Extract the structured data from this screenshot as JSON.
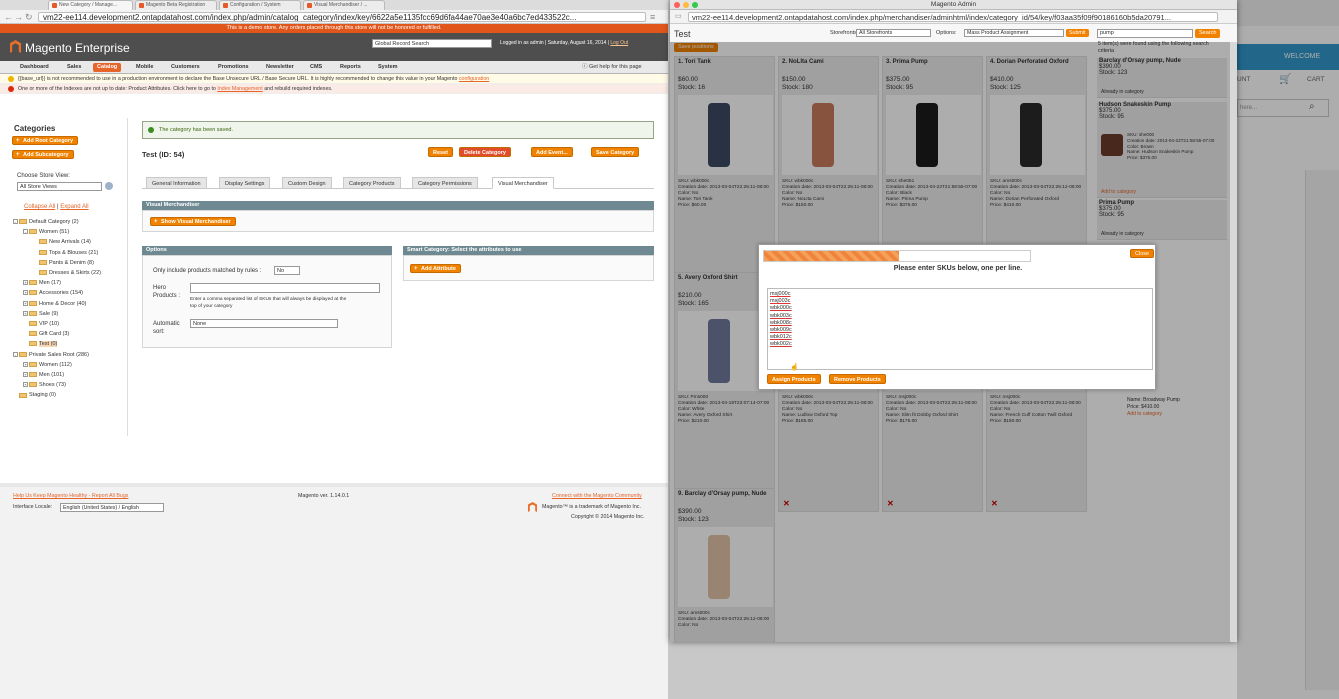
{
  "left_browser": {
    "tabs": [
      "New Category / Manage...",
      "Magento Beta Registration",
      "Configuration / System",
      "Visual Merchandiser / ..."
    ],
    "url": "vm22-ee114.development2.ontapdatahost.com/index.php/admin/catalog_category/index/key/6622a5e1135fcc69d6fa44ae70ae3e40a6bc7ed433522c...",
    "demo_notice": "This is a demo store. Any orders placed through this store will not be honored or fulfilled.",
    "logo_text": "Magento Enterprise",
    "global_search_placeholder": "Global Record Search",
    "header_meta_prefix": "Logged in as admin | Saturday, August 16, 2014 |",
    "logout": "Log Out",
    "nav": [
      "Dashboard",
      "Sales",
      "Catalog",
      "Mobile",
      "Customers",
      "Promotions",
      "Newsletter",
      "CMS",
      "Reports",
      "System"
    ],
    "help_link": "Get help for this page",
    "messages": {
      "warning_text": "{{base_url}} is not recommended to use in a production environment to declare the Base Unsecure URL / Base Secure URL. It is highly recommended to change this value in your Magento",
      "warning_link": "configuration",
      "error_text": "One or more of the Indexes are not up to date: Product Attributes. Click here to go to",
      "error_link": "Index Management",
      "error_tail": "and rebuild required indexes."
    },
    "sidebar": {
      "title": "Categories",
      "add_root": "Add Root Category",
      "add_sub": "Add Subcategory",
      "store_view_label": "Choose Store View:",
      "store_view_value": "All Store Views",
      "collapse_all": "Collapse All",
      "expand_all": "Expand All",
      "tree": [
        {
          "label": "Default Category (2)",
          "level": 0,
          "sign": "-"
        },
        {
          "label": "Women (51)",
          "level": 1,
          "sign": "-"
        },
        {
          "label": "New Arrivals (14)",
          "level": 2,
          "sign": ""
        },
        {
          "label": "Tops & Blouses (21)",
          "level": 2,
          "sign": ""
        },
        {
          "label": "Pants & Denim (8)",
          "level": 2,
          "sign": ""
        },
        {
          "label": "Dresses & Skirts (22)",
          "level": 2,
          "sign": ""
        },
        {
          "label": "Men (17)",
          "level": 1,
          "sign": "+"
        },
        {
          "label": "Accessories (154)",
          "level": 1,
          "sign": "+"
        },
        {
          "label": "Home & Decor (40)",
          "level": 1,
          "sign": "+"
        },
        {
          "label": "Sale (9)",
          "level": 1,
          "sign": "+"
        },
        {
          "label": "VIP (10)",
          "level": 1,
          "sign": ""
        },
        {
          "label": "Gift Card (3)",
          "level": 1,
          "sign": ""
        },
        {
          "label": "Test (0)",
          "level": 1,
          "sign": "",
          "current": true
        },
        {
          "label": "Private Sales Root (286)",
          "level": 0,
          "sign": "-"
        },
        {
          "label": "Women (112)",
          "level": 1,
          "sign": "+"
        },
        {
          "label": "Men (101)",
          "level": 1,
          "sign": "+"
        },
        {
          "label": "Shoes (73)",
          "level": 1,
          "sign": "+"
        },
        {
          "label": "Staging (0)",
          "level": 0,
          "sign": ""
        }
      ]
    },
    "main": {
      "success": "The category has been saved.",
      "title": "Test (ID: 54)",
      "buttons": {
        "reset": "Reset",
        "delete": "Delete Category",
        "add_event": "Add Event...",
        "save": "Save Category"
      },
      "tabs": [
        "General Information",
        "Display Settings",
        "Custom Design",
        "Category Products",
        "Category Permissions",
        "Visual Merchandiser"
      ],
      "vm_header": "Visual Merchandiser",
      "show_vm_button": "Show Visual Merchandiser",
      "options_header": "Options",
      "only_include_label": "Only include products matched by rules :",
      "only_include_value": "No",
      "hero_label": "Hero Products :",
      "hero_note": "Enter a comma separated list of SKUs that will always be displayed at the top of your category",
      "auto_sort_label": "Automatic sort:",
      "auto_sort_value": "None",
      "smart_header": "Smart Category: Select the attributes to use",
      "add_attribute": "Add Attribute"
    },
    "footer": {
      "help_link": "Help Us Keep Magento Healthy - Report All Bugs",
      "version": "Magento ver. 1.14.0.1",
      "community": "Connect with the Magento Community",
      "trademark": "Magento™ is a trademark of Magento Inc.",
      "copyright": "Copyright © 2014 Magento Inc.",
      "locale_label": "Interface Locale:",
      "locale_value": "English (United States) / English"
    }
  },
  "popup": {
    "title": "Magento Admin",
    "url": "vm22-ee114.development2.ontapdatahost.com/index.php/merchandiser/adminhtml/index/category_id/54/key/f03aa35f09f90186160b5da20791...",
    "save_positions": "Save positions",
    "storefronts_label": "Storefronts :",
    "storefronts_value": "All Storefronts",
    "options_label": "Options:",
    "options_value": "Mass Product Assignment",
    "submit": "Submit",
    "search_value": "pump",
    "search_button": "Search",
    "results_note": "5 item(s) were found using the following search criteria",
    "category_title": "Test",
    "products": [
      {
        "name": "1. Tori Tank",
        "price": "$60.00",
        "stock": "Stock: 16",
        "sku": "SKU: wbk000c",
        "created": "Creation date: 2013-03-04T22:25:11-08:00",
        "color": "Color: No",
        "pname": "Name: Tori Tank",
        "pprice": "Price: $60.00"
      },
      {
        "name": "2. NoLIta Cami",
        "price": "$150.00",
        "stock": "Stock: 180",
        "sku": "SKU: wbk000c",
        "created": "Creation date: 2013-03-04T22:25:11-08:00",
        "color": "Color: No",
        "pname": "Name: NoLIta Cami",
        "pprice": "Price: $150.00"
      },
      {
        "name": "3. Prima Pump",
        "price": "$375.00",
        "stock": "Stock: 95",
        "sku": "SKU: she051",
        "created": "Creation date: 2013-04-22T21:58:55-07:00",
        "color": "Color: Black",
        "pname": "Name: Prima Pump",
        "pprice": "Price: $375.00"
      },
      {
        "name": "4. Dorian Perforated Oxford",
        "price": "$410.00",
        "stock": "Stock: 125",
        "sku": "SKU: ams000c",
        "created": "Creation date: 2013-03-04T22:25:12-08:00",
        "color": "Color: No",
        "pname": "Name: Dorian Perforated Oxford",
        "pprice": "Price: $410.00"
      },
      {
        "name": "5. Avery Oxford Shirt",
        "price": "$210.00",
        "stock": "Stock: 165",
        "sku": "SKU: Pms000",
        "created": "Creation date: 2013-04-18T23:07:14-07:00",
        "color": "Color: White",
        "pname": "Name: Avery Oxford Shirt",
        "pprice": "Price: $210.00"
      },
      {
        "name": "",
        "price": "",
        "stock": "",
        "sku": "SKU: wbk000c",
        "created": "Creation date: 2013-03-04T22:25:11-08:00",
        "color": "Color: No",
        "pname": "Name: Ludlow Oxford Top",
        "pprice": "Price: $185.00"
      },
      {
        "name": "",
        "price": "",
        "stock": "",
        "sku": "SKU: msj000c",
        "created": "Creation date: 2013-03-04T22:25:11-08:00",
        "color": "Color: No",
        "pname": "Name: Slim fit Dobby Oxford Shirt",
        "pprice": "Price: $175.00"
      },
      {
        "name": "",
        "price": "",
        "stock": "",
        "sku": "SKU: msj000c",
        "created": "Creation date: 2013-03-04T22:25:11-08:00",
        "color": "Color: No",
        "pname": "Name: French Cuff Cotton Twill Oxford",
        "pprice": "Price: $190.00"
      },
      {
        "name": "9. Barclay d'Orsay pump, Nude",
        "price": "$390.00",
        "stock": "Stock: 123",
        "sku": "SKU: ams000c",
        "created": "Creation date: 2013-03-04T22:25:12-08:00",
        "color": "Color: No",
        "pname": "",
        "pprice": ""
      }
    ],
    "right_column": [
      {
        "name": "Barclay d'Orsay pump, Nude",
        "price": "$390.00",
        "stock": "Stock: 123",
        "status": "Already in category"
      },
      {
        "name": "Hudson Snakeskin Pump",
        "price": "$375.00",
        "stock": "Stock: 95",
        "sku": "SKU: she000",
        "created": "Creation date: 2013-04-22T21:58:55-07:00",
        "color": "Color: Brown",
        "pname": "Name: Hudson Snakeskin Pump",
        "pprice": "Price: $375.00",
        "status": "Add to category"
      },
      {
        "name": "Prima Pump",
        "price": "$375.00",
        "stock": "Stock: 95",
        "status": "Already in category"
      }
    ],
    "right_column_partial": {
      "name_tail": "Name: Broadway Pump",
      "price": "Price: $410.00",
      "created": "Creation date: 2013-03-04T22:25:11-07:00",
      "status": "Add to category",
      "pump": "Pump",
      "add_cat": "category"
    },
    "modal": {
      "instruction": "Please enter SKUs below, one per line.",
      "close": "Close",
      "skus": [
        "msj000c",
        "msj003c",
        "wbk000c",
        "wbk003c",
        "wbk008c",
        "wbk009c",
        "wbk012c",
        "wbk002c"
      ],
      "assign": "Assign Products",
      "remove": "Remove Products"
    }
  },
  "bg_window": {
    "welcome": "WELCOME",
    "account": "UNT",
    "cart": "CART",
    "search_placeholder": "here..."
  },
  "colors": {
    "orange": "#f18200",
    "header": "#4e4e4e",
    "accent": "#e5652a"
  }
}
